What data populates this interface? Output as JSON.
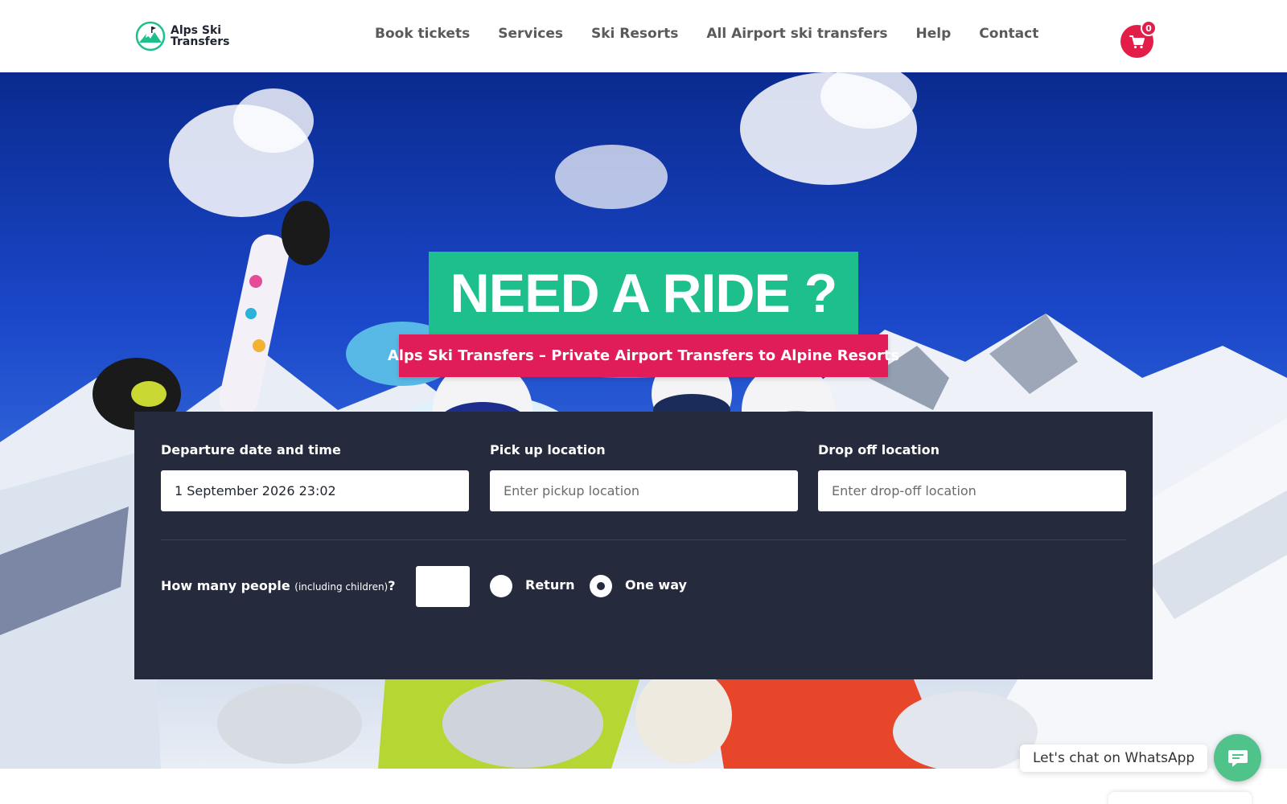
{
  "brand": {
    "line1": "Alps Ski",
    "line2": "Transfers"
  },
  "nav": {
    "items": [
      {
        "label": "Book tickets"
      },
      {
        "label": "Services"
      },
      {
        "label": "Ski Resorts"
      },
      {
        "label": "All Airport ski transfers"
      },
      {
        "label": "Help"
      },
      {
        "label": "Contact"
      }
    ]
  },
  "cart": {
    "count": "0",
    "icon": "cart-icon"
  },
  "hero": {
    "title": "NEED A RIDE ?",
    "subtitle": "Alps Ski Transfers – Private Airport Transfers to Alpine Resorts"
  },
  "form": {
    "departure": {
      "label": "Departure date and time",
      "value": "1 September 2026 23:02"
    },
    "pickup": {
      "label": "Pick up location",
      "placeholder": "Enter pickup location"
    },
    "dropoff": {
      "label": "Drop off location",
      "placeholder": "Enter drop-off location"
    },
    "people": {
      "label": "How many people",
      "note": "(including children)",
      "suffix": "?",
      "value": ""
    },
    "trip_type": {
      "options": [
        {
          "label": "Return",
          "selected": false
        },
        {
          "label": "One way",
          "selected": true
        }
      ]
    }
  },
  "whatsapp": {
    "text": "Let's chat on WhatsApp",
    "icon": "chat-icon"
  },
  "colors": {
    "accent_green": "#1dbf8c",
    "accent_pink": "#e11d59",
    "panel": "#252b3c",
    "whatsapp": "#4fc38a"
  }
}
